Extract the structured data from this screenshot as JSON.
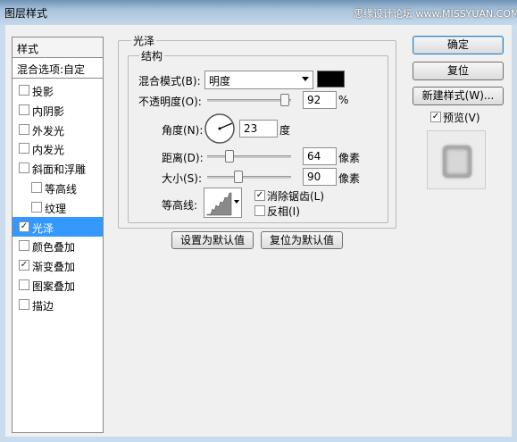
{
  "window": {
    "title": "图层样式",
    "watermark": "思缘设计论坛 www.MISSYUAN.COM"
  },
  "styles_panel": {
    "header": "样式",
    "blend_options": "混合选项:自定",
    "items": [
      {
        "label": "投影",
        "checked": false,
        "selected": false,
        "indent": false
      },
      {
        "label": "内阴影",
        "checked": false,
        "selected": false,
        "indent": false
      },
      {
        "label": "外发光",
        "checked": false,
        "selected": false,
        "indent": false
      },
      {
        "label": "内发光",
        "checked": false,
        "selected": false,
        "indent": false
      },
      {
        "label": "斜面和浮雕",
        "checked": false,
        "selected": false,
        "indent": false
      },
      {
        "label": "等高线",
        "checked": false,
        "selected": false,
        "indent": true
      },
      {
        "label": "纹理",
        "checked": false,
        "selected": false,
        "indent": true
      },
      {
        "label": "光泽",
        "checked": true,
        "selected": true,
        "indent": false
      },
      {
        "label": "颜色叠加",
        "checked": false,
        "selected": false,
        "indent": false
      },
      {
        "label": "渐变叠加",
        "checked": true,
        "selected": false,
        "indent": false
      },
      {
        "label": "图案叠加",
        "checked": false,
        "selected": false,
        "indent": false
      },
      {
        "label": "描边",
        "checked": false,
        "selected": false,
        "indent": false
      }
    ]
  },
  "satin": {
    "group_title": "光泽",
    "structure_title": "结构",
    "blend_mode_label": "混合模式(B):",
    "blend_mode_value": "明度",
    "color": "#000000",
    "opacity_label": "不透明度(O):",
    "opacity_value": "92",
    "opacity_unit": "%",
    "angle_label": "角度(N):",
    "angle_value": "23",
    "angle_unit": "度",
    "distance_label": "距离(D):",
    "distance_value": "64",
    "distance_unit": "像素",
    "size_label": "大小(S):",
    "size_value": "90",
    "size_unit": "像素",
    "contour_label": "等高线:",
    "anti_alias_label": "消除锯齿(L)",
    "anti_alias_checked": true,
    "invert_label": "反相(I)",
    "invert_checked": false,
    "make_default": "设置为默认值",
    "reset_default": "复位为默认值"
  },
  "buttons": {
    "ok": "确定",
    "reset": "复位",
    "new_style": "新建样式(W)...",
    "preview_label": "预览(V)",
    "preview_checked": true
  }
}
